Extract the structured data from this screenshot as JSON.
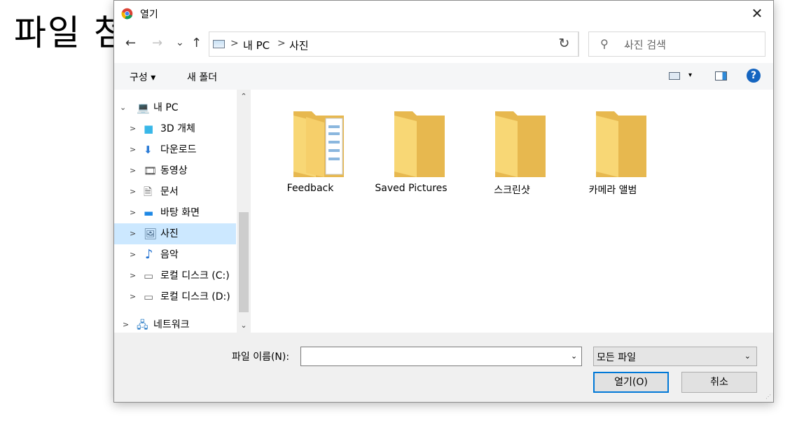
{
  "background": {
    "title": "파일 첨"
  },
  "dialog": {
    "title": "열기",
    "close_glyph": "✕",
    "nav": {
      "back": "←",
      "forward": "→",
      "recent": "⌄",
      "up": "↑"
    },
    "address": {
      "crumbs": [
        "내 PC",
        "사진"
      ],
      "sep": ">",
      "dropdown": "⌄",
      "refresh": "↻"
    },
    "search": {
      "placeholder": "사진 검색"
    },
    "toolbar": {
      "organize": "구성 ▾",
      "new_folder": "새 폴더",
      "help": "?",
      "view_dropdown": "▾"
    },
    "tree": {
      "items": [
        {
          "label": "내 PC",
          "chevron": "⌄",
          "icon": "pc-icon",
          "glyph": "💻",
          "color": "#3b7fd4"
        },
        {
          "label": "3D 개체",
          "chevron": ">",
          "icon": "cube-icon",
          "glyph": "■",
          "color": "#38b7e8"
        },
        {
          "label": "다운로드",
          "chevron": ">",
          "icon": "download-icon",
          "glyph": "⬇",
          "color": "#2b7bd6"
        },
        {
          "label": "동영상",
          "chevron": ">",
          "icon": "video-icon",
          "glyph": "🎞",
          "color": "#444444"
        },
        {
          "label": "문서",
          "chevron": ">",
          "icon": "document-icon",
          "glyph": "🗎",
          "color": "#666666"
        },
        {
          "label": "바탕 화면",
          "chevron": ">",
          "icon": "desktop-icon",
          "glyph": "▬",
          "color": "#1e88e5"
        },
        {
          "label": "사진",
          "chevron": ">",
          "icon": "pictures-icon",
          "glyph": "🖼",
          "color": "#4a6a8a"
        },
        {
          "label": "음악",
          "chevron": ">",
          "icon": "music-icon",
          "glyph": "♪",
          "color": "#1e6fd0"
        },
        {
          "label": "로컬 디스크 (C:)",
          "chevron": ">",
          "icon": "drive-c-icon",
          "glyph": "▭",
          "color": "#6a6a6a"
        },
        {
          "label": "로컬 디스크 (D:)",
          "chevron": ">",
          "icon": "drive-d-icon",
          "glyph": "▭",
          "color": "#6a6a6a"
        },
        {
          "label": "네트워크",
          "chevron": ">",
          "icon": "network-icon",
          "glyph": "🖧",
          "color": "#2f7fc8"
        }
      ],
      "selected": "사진",
      "scroll_up": "⌃",
      "scroll_down": "⌄"
    },
    "files": [
      {
        "label": "Feedback",
        "type": "folder-with-documents"
      },
      {
        "label": "Saved Pictures",
        "type": "folder"
      },
      {
        "label": "스크린샷",
        "type": "folder"
      },
      {
        "label": "카메라 앨범",
        "type": "folder"
      }
    ],
    "footer": {
      "filename_label": "파일 이름(N):",
      "filename_value": "",
      "filename_dropdown": "⌄",
      "filter_label": "모든 파일",
      "filter_dropdown": "⌄",
      "open_button": "열기(O)",
      "cancel_button": "취소"
    },
    "colors": {
      "accent": "#0078d7",
      "selection": "#cce8ff",
      "folder": "#f8d775"
    }
  }
}
